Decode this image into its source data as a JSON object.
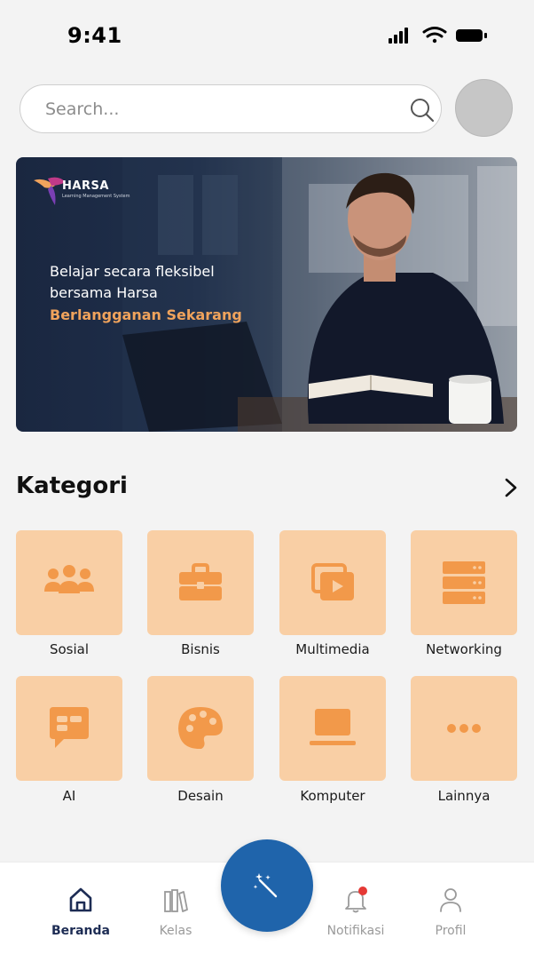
{
  "status_bar": {
    "time": "9:41"
  },
  "search": {
    "placeholder": "Search..."
  },
  "banner": {
    "logo_text": "HARSA",
    "logo_tagline": "Learning Management System",
    "headline_line1": "Belajar secara fleksibel",
    "headline_line2": "bersama Harsa",
    "cta": "Berlangganan Sekarang"
  },
  "categories": {
    "title": "Kategori",
    "items": [
      {
        "label": "Sosial",
        "icon": "people-icon"
      },
      {
        "label": "Bisnis",
        "icon": "briefcase-icon"
      },
      {
        "label": "Multimedia",
        "icon": "media-play-icon"
      },
      {
        "label": "Networking",
        "icon": "server-icon"
      },
      {
        "label": "AI",
        "icon": "chat-icon"
      },
      {
        "label": "Desain",
        "icon": "palette-icon"
      },
      {
        "label": "Komputer",
        "icon": "laptop-icon"
      },
      {
        "label": "Lainnya",
        "icon": "more-dots-icon"
      }
    ]
  },
  "bottom_nav": {
    "items": [
      {
        "label": "Beranda",
        "icon": "home-icon",
        "active": true
      },
      {
        "label": "Kelas",
        "icon": "books-icon",
        "active": false
      },
      {
        "label": "Notifikasi",
        "icon": "bell-icon",
        "active": false,
        "badge": true
      },
      {
        "label": "Profil",
        "icon": "user-icon",
        "active": false
      }
    ],
    "fab_icon": "magic-wand-icon"
  },
  "colors": {
    "accent_orange": "#f0a35c",
    "tile_background": "#f9cfa5",
    "icon_orange": "#f2994a",
    "primary_blue": "#1f64ab",
    "nav_active": "#1d2c54",
    "badge_red": "#e53935"
  }
}
